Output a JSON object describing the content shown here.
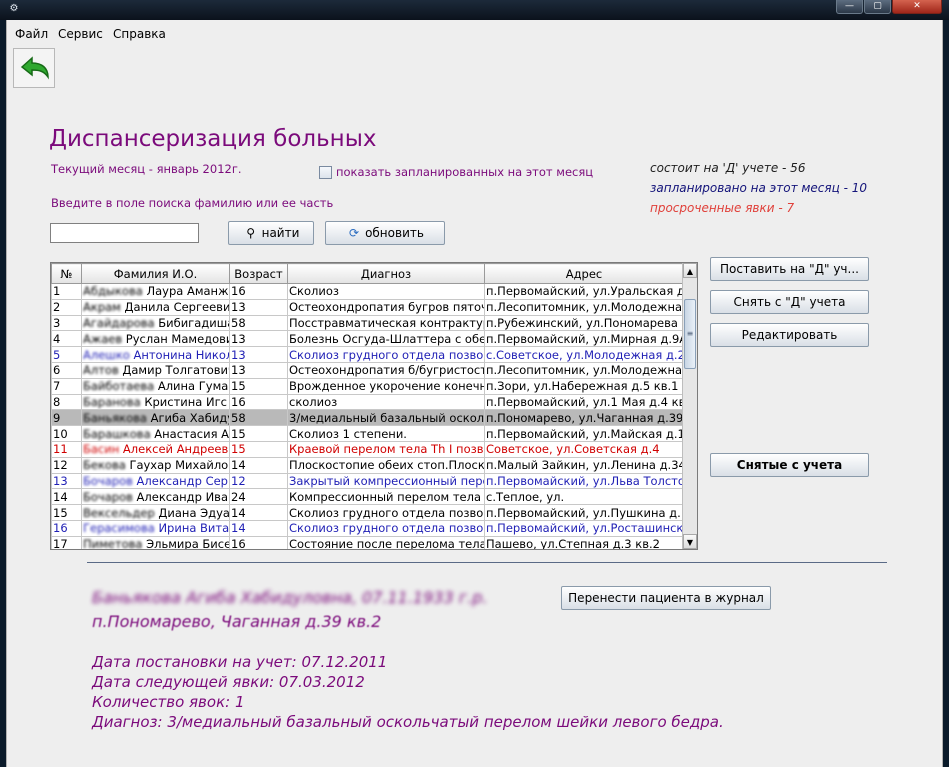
{
  "colors": {
    "accent": "#7b0a7b",
    "blue_row": "#1f1fb5",
    "red_row": "#d00000",
    "selected_row": "#b9b9b9"
  },
  "menu": {
    "file": "Файл",
    "service": "Сервис",
    "help": "Справка"
  },
  "toolbar": {
    "back_icon": "green-back-arrow-icon"
  },
  "header": {
    "title": "Диспансеризация больных",
    "current_month": "Текущий месяц - январь 2012г.",
    "show_planned_label": "показать запланированных на этот месяц",
    "show_planned_checked": false,
    "stats": {
      "registered": "состоит на 'Д' учете - 56",
      "planned": "запланировано на этот месяц - 10",
      "overdue": "просроченные явки - 7"
    }
  },
  "search": {
    "hint": "Введите в поле поиска фамилию или ее часть",
    "value": "",
    "find_label": "найти",
    "refresh_label": "обновить"
  },
  "actions": {
    "register_label": "Поставить на \"Д\" уч...",
    "deregister_label": "Снять с \"Д\" учета",
    "edit_label": "Редактировать",
    "removed_label": "Снятые с учета",
    "move_to_journal_label": "Перенести пациента в журнал"
  },
  "table": {
    "columns": [
      "№",
      "Фамилия И.О.",
      "Возраст",
      "Диагноз",
      "Адрес"
    ],
    "rows": [
      {
        "n": "1",
        "name": "Абдыкова Лаура Аманжол",
        "age": "16",
        "diagnosis": "Сколиоз",
        "address": "п.Первомайский, ул.Уральская д.3",
        "style": "normal"
      },
      {
        "n": "2",
        "name": "Акрам Данила Сергеевич",
        "age": "13",
        "diagnosis": "Остеохондропатия бугров пяточных",
        "address": "п.Лесопитомник, ул.Молодежная д.",
        "style": "normal"
      },
      {
        "n": "3",
        "name": "Агайдарова Бибигадиша К",
        "age": "58",
        "diagnosis": "Посстравматическая контрактура",
        "address": "п.Рубежинский, ул.Пономарева д.1",
        "style": "normal"
      },
      {
        "n": "4",
        "name": "Ажаев Руслан Мамедович",
        "age": "13",
        "diagnosis": "Болезнь Осгуда-Шлаттера с обеих",
        "address": "п.Первомайский, ул.Мирная д.9А к",
        "style": "normal"
      },
      {
        "n": "5",
        "name": "Алешко Антонина Никола",
        "age": "13",
        "diagnosis": "Сколиоз грудного отдела позвоночн",
        "address": "с.Советское, ул.Молодежная д.24",
        "style": "blue"
      },
      {
        "n": "6",
        "name": "Алтов Дамир Толгатович",
        "age": "13",
        "diagnosis": "Остеохондропатия б/бугристости б",
        "address": "п.Лесопитомник, ул.Молодежная д",
        "style": "normal"
      },
      {
        "n": "7",
        "name": "Байботаева Алина Гумар",
        "age": "15",
        "diagnosis": "Врожденное укорочение конечнос",
        "address": "п.Зори, ул.Набережная д.5 кв.1",
        "style": "normal"
      },
      {
        "n": "8",
        "name": "Баранова Кристина Игс",
        "age": "16",
        "diagnosis": "сколиоз",
        "address": "п.Первомайский, ул.1 Мая д.4 кв.1",
        "style": "normal"
      },
      {
        "n": "9",
        "name": "Баньякова Агиба Хабидул",
        "age": "58",
        "diagnosis": "3/медиальный базальный оскольч",
        "address": "п.Пономарево, ул.Чаганная д.39 к",
        "style": "selected"
      },
      {
        "n": "10",
        "name": "Барашкова Анастасия Анд",
        "age": "15",
        "diagnosis": "Сколиоз 1 степени.",
        "address": "п.Первомайский, ул.Майская д.10",
        "style": "normal"
      },
      {
        "n": "11",
        "name": "Басин Алексей Андреевич",
        "age": "15",
        "diagnosis": "Краевой перелом тела Th I позвонк",
        "address": "Советское, ул.Советская д.4",
        "style": "red"
      },
      {
        "n": "12",
        "name": "Бекова Гаухар Михайлов",
        "age": "14",
        "diagnosis": "Плоскостопие обеих стоп.Плоско-",
        "address": "п.Малый Зайкин, ул.Ленина д.34 кв",
        "style": "normal"
      },
      {
        "n": "13",
        "name": "Бочаров Александр Серге",
        "age": "12",
        "diagnosis": "Закрытый компрессионный перел",
        "address": "п.Первомайский, ул.Льва Толстого",
        "style": "blue"
      },
      {
        "n": "14",
        "name": "Бочаров Александр Ивано",
        "age": "24",
        "diagnosis": "Компрессионный перелом тела L",
        "address": "с.Теплое, ул.",
        "style": "normal"
      },
      {
        "n": "15",
        "name": "Вексельдер Диана Эдуар",
        "age": "14",
        "diagnosis": "Сколиоз грудного отдела позвоно",
        "address": "п.Первомайский, ул.Пушкина д.19 к",
        "style": "normal"
      },
      {
        "n": "16",
        "name": "Герасимова Ирина Витал",
        "age": "14",
        "diagnosis": "Сколиоз грудного отдела позвоноч",
        "address": "п.Первомайский, ул.Росташинская",
        "style": "blue"
      },
      {
        "n": "17",
        "name": "Пиметова Эльмира Бисе",
        "age": "16",
        "diagnosis": "Состояние после перелома тела L",
        "address": "Пашево, ул.Степная д.3 кв.2",
        "style": "normal"
      }
    ]
  },
  "patient": {
    "name_dob": "Баньякова Агиба Хабидуловна, 07.11.1933 г.р.",
    "address": "п.Пономарево, Чаганная д.39 кв.2",
    "registration_date": "Дата постановки на учет: 07.12.2011",
    "next_visit": "Дата следующей явки: 07.03.2012",
    "visit_count": "Количество явок: 1",
    "diagnosis": "Диагноз: 3/медиальный базальный оскольчатый перелом шейки левого бедра."
  }
}
